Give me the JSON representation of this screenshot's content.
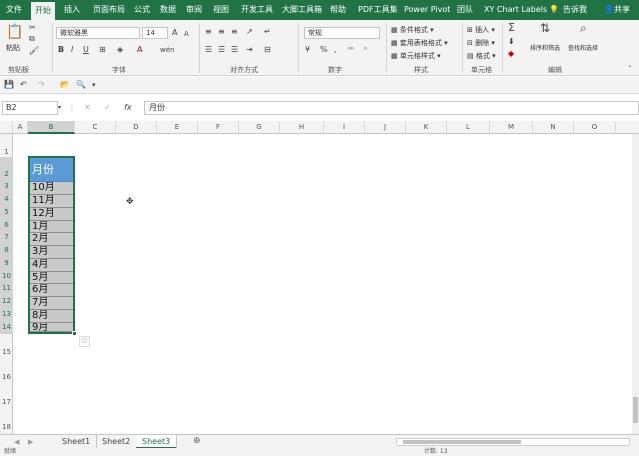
{
  "ribbon_tabs": [
    {
      "label": "文件"
    },
    {
      "label": "开始",
      "active": true
    },
    {
      "label": "插入"
    },
    {
      "label": "页面布局"
    },
    {
      "label": "公式"
    },
    {
      "label": "数据"
    },
    {
      "label": "审阅"
    },
    {
      "label": "视图"
    },
    {
      "label": "开发工具"
    },
    {
      "label": "大脚工具箱"
    },
    {
      "label": "帮助"
    },
    {
      "label": "PDF工具集"
    },
    {
      "label": "Power Pivot"
    },
    {
      "label": "团队"
    },
    {
      "label": "XY Chart Labels"
    },
    {
      "label": "告诉我"
    },
    {
      "label": "共享"
    }
  ],
  "ribbon": {
    "clipboard": {
      "paste": "粘贴",
      "group": "剪贴板"
    },
    "font": {
      "name": "微软雅黑",
      "size": "14",
      "group": "字体",
      "bold": "B",
      "italic": "I",
      "underline": "U",
      "grow": "A",
      "shrink": "A",
      "wen": "wén"
    },
    "alignment": {
      "group": "对齐方式"
    },
    "number": {
      "format": "常规",
      "group": "数字",
      "percent": "%",
      "comma": ","
    },
    "styles": {
      "conditional": "条件格式",
      "table": "套用表格格式",
      "cell": "单元格样式",
      "group": "样式"
    },
    "cells": {
      "insert": "插入",
      "delete": "删除",
      "format": "格式",
      "group": "单元格"
    },
    "editing": {
      "sort": "排序和筛选",
      "find": "查找和选择",
      "group": "编辑",
      "sigma": "Σ"
    }
  },
  "formula_bar": {
    "name_box": "B2",
    "content": "月份",
    "cancel": "✕",
    "enter": "✓",
    "fx": "fx"
  },
  "columns": [
    "A",
    "B",
    "C",
    "D",
    "E",
    "F",
    "G",
    "H",
    "I",
    "J",
    "K",
    "L",
    "M",
    "N",
    "O"
  ],
  "rows": [
    "1",
    "2",
    "3",
    "4",
    "5",
    "6",
    "7",
    "8",
    "9",
    "10",
    "11",
    "12",
    "13",
    "14",
    "15",
    "16",
    "17",
    "18"
  ],
  "cells": {
    "header": "月份",
    "values": [
      "10月",
      "11月",
      "12月",
      "1月",
      "2月",
      "3月",
      "4月",
      "5月",
      "6月",
      "7月",
      "8月",
      "9月"
    ]
  },
  "sheets": [
    "Sheet1",
    "Sheet2",
    "Sheet3"
  ],
  "active_sheet": "Sheet3",
  "status": {
    "left": "就绪",
    "count": "计数: 13"
  },
  "colors": {
    "accent": "#217346",
    "header_fill": "#5b9bd5",
    "data_fill": "#c9c9c9"
  }
}
